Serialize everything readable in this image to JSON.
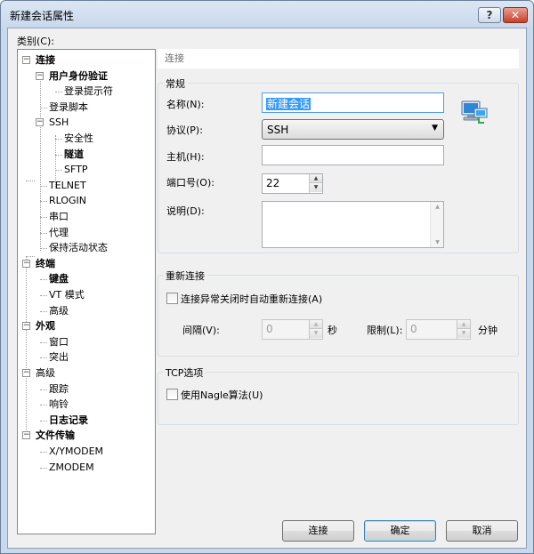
{
  "window": {
    "title": "新建会话属性"
  },
  "categories_label": "类别(C):",
  "tree": [
    {
      "label": "连接",
      "bold": true
    },
    {
      "label": "用户身份验证",
      "bold": true
    },
    {
      "label": "登录提示符",
      "bold": false
    },
    {
      "label": "登录脚本",
      "bold": false
    },
    {
      "label": "SSH",
      "bold": false
    },
    {
      "label": "安全性",
      "bold": false
    },
    {
      "label": "隧道",
      "bold": true
    },
    {
      "label": "SFTP",
      "bold": false
    },
    {
      "label": "TELNET",
      "bold": false
    },
    {
      "label": "RLOGIN",
      "bold": false
    },
    {
      "label": "串口",
      "bold": false
    },
    {
      "label": "代理",
      "bold": false
    },
    {
      "label": "保持活动状态",
      "bold": false
    },
    {
      "label": "终端",
      "bold": true
    },
    {
      "label": "键盘",
      "bold": true
    },
    {
      "label": "VT 模式",
      "bold": false
    },
    {
      "label": "高级",
      "bold": false
    },
    {
      "label": "外观",
      "bold": true
    },
    {
      "label": "窗口",
      "bold": false
    },
    {
      "label": "突出",
      "bold": false
    },
    {
      "label": "高级",
      "bold": false
    },
    {
      "label": "跟踪",
      "bold": false
    },
    {
      "label": "响铃",
      "bold": false
    },
    {
      "label": "日志记录",
      "bold": true
    },
    {
      "label": "文件传输",
      "bold": true
    },
    {
      "label": "X/YMODEM",
      "bold": false
    },
    {
      "label": "ZMODEM",
      "bold": false
    }
  ],
  "panel": {
    "header": "连接",
    "general": {
      "title": "常规",
      "name_label": "名称(N):",
      "name_value": "新建会话",
      "protocol_label": "协议(P):",
      "protocol_value": "SSH",
      "host_label": "主机(H):",
      "host_value": "",
      "port_label": "端口号(O):",
      "port_value": "22",
      "desc_label": "说明(D):",
      "desc_value": ""
    },
    "reconnect": {
      "title": "重新连接",
      "auto_label": "连接异常关闭时自动重新连接(A)",
      "interval_label": "间隔(V):",
      "interval_value": "0",
      "interval_unit": "秒",
      "limit_label": "限制(L):",
      "limit_value": "0",
      "limit_unit": "分钟"
    },
    "tcp": {
      "title": "TCP选项",
      "nagle_label": "使用Nagle算法(U)"
    }
  },
  "buttons": {
    "connect": "连接",
    "ok": "确定",
    "cancel": "取消"
  },
  "icons": {
    "help": "question-icon",
    "close": "close-icon",
    "network": "network-computer-icon"
  }
}
